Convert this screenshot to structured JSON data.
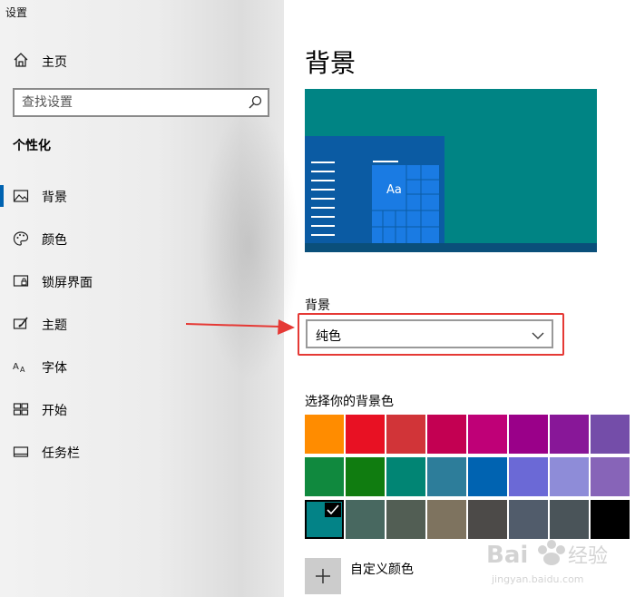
{
  "app": {
    "title": "设置"
  },
  "sidebar": {
    "home_label": "主页",
    "search_placeholder": "查找设置",
    "section_label": "个性化",
    "items": [
      {
        "label": "背景",
        "icon": "image-icon",
        "active": true
      },
      {
        "label": "颜色",
        "icon": "palette-icon",
        "active": false
      },
      {
        "label": "锁屏界面",
        "icon": "lock-screen-icon",
        "active": false
      },
      {
        "label": "主题",
        "icon": "theme-brush-icon",
        "active": false
      },
      {
        "label": "字体",
        "icon": "font-icon",
        "active": false
      },
      {
        "label": "开始",
        "icon": "start-tiles-icon",
        "active": false
      },
      {
        "label": "任务栏",
        "icon": "taskbar-icon",
        "active": false
      }
    ]
  },
  "main": {
    "page_title": "背景",
    "preview_sample_text": "Aa",
    "background_label": "背景",
    "background_value": "纯色",
    "colors_label": "选择你的背景色",
    "custom_color_label": "自定义颜色",
    "swatches": [
      [
        "#ff8c00",
        "#e81123",
        "#d13438",
        "#c30052",
        "#bf0077",
        "#9a0089",
        "#881798",
        "#744da9"
      ],
      [
        "#10893e",
        "#107c10",
        "#018574",
        "#2d7d9a",
        "#0063b1",
        "#6b69d6",
        "#8e8cd8",
        "#8764b8"
      ],
      [
        "#038387",
        "#486860",
        "#525e54",
        "#7e735f",
        "#4c4a48",
        "#515c6b",
        "#4a5459",
        "#000000"
      ]
    ],
    "selected_swatch": "#038387"
  },
  "colors": {
    "accent": "#0063b1",
    "preview_bg": "#008484",
    "highlight": "#e53935"
  },
  "watermark": {
    "text": "Bai 经验",
    "sub": "jingyan.baidu.com"
  }
}
